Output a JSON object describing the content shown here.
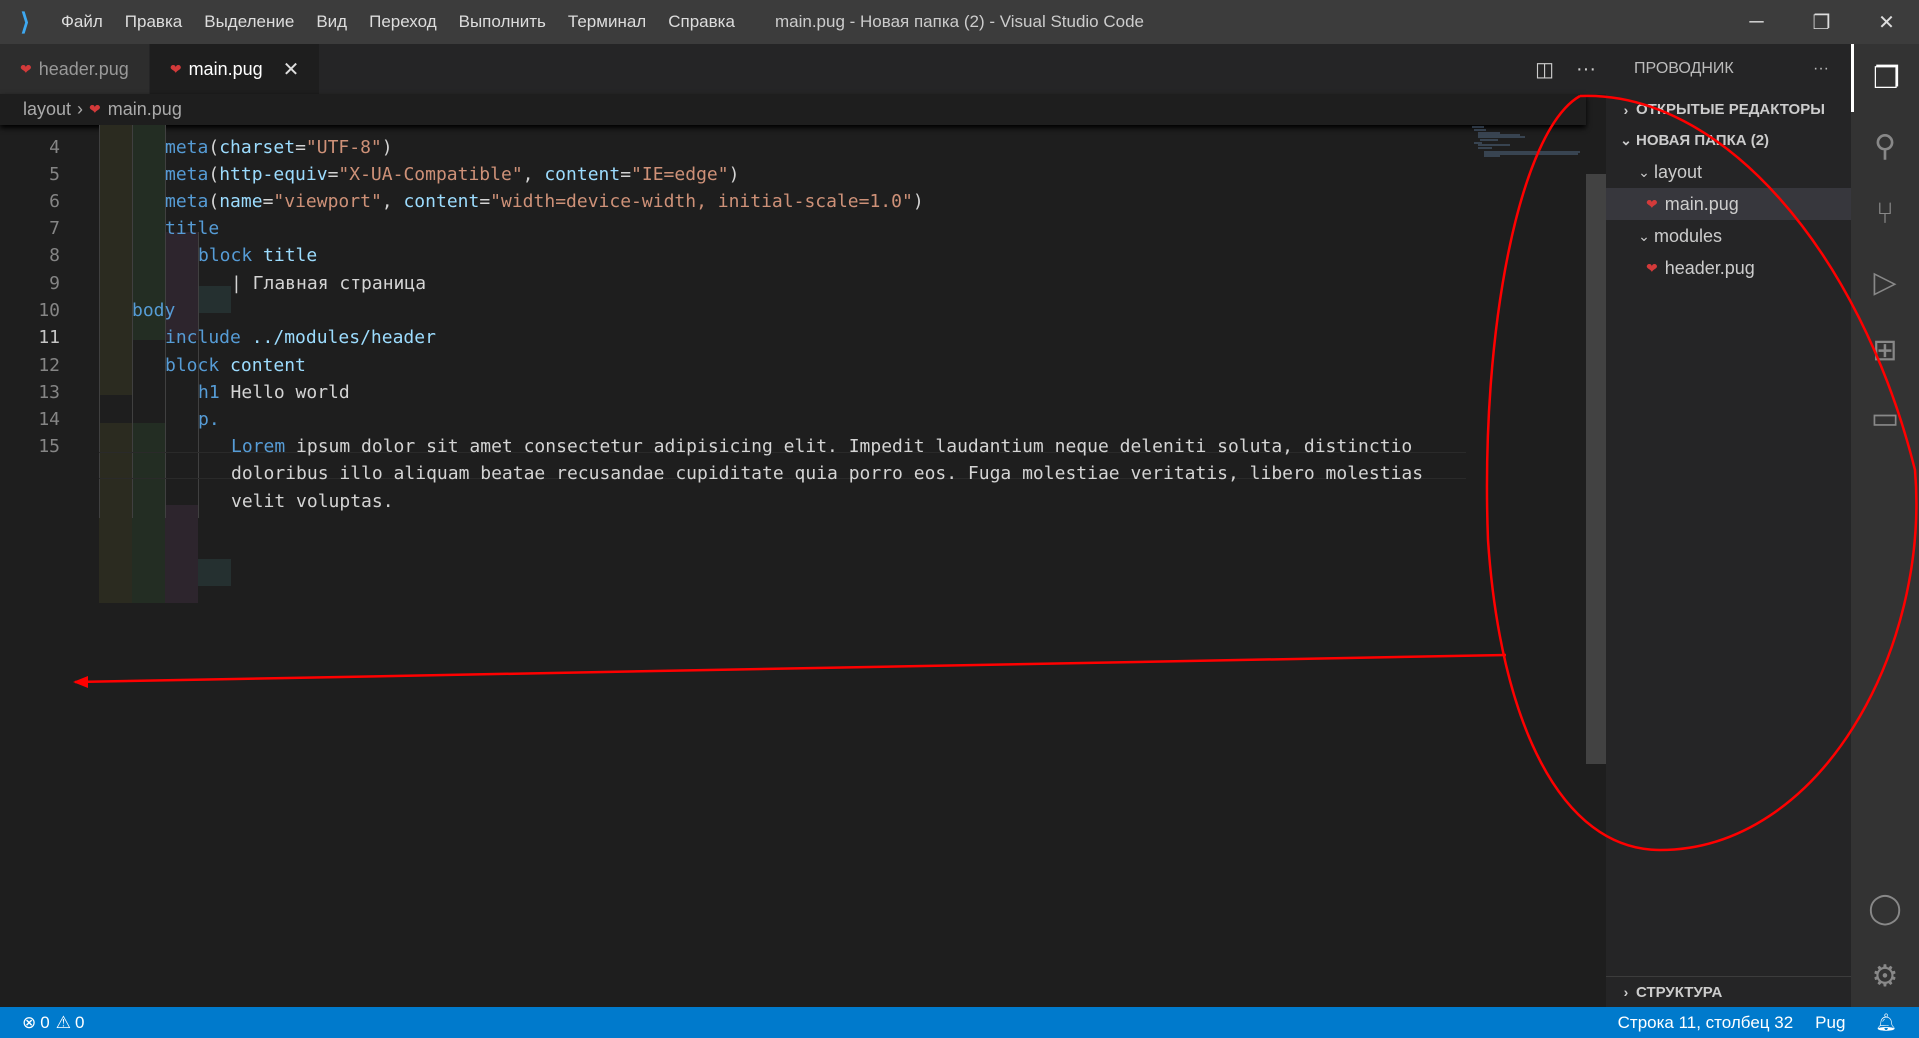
{
  "window": {
    "title": "main.pug - Новая папка (2) - Visual Studio Code",
    "minimize": "─",
    "restore": "❐",
    "close": "✕"
  },
  "menu": [
    "Файл",
    "Правка",
    "Выделение",
    "Вид",
    "Переход",
    "Выполнить",
    "Терминал",
    "Справка"
  ],
  "tabs": [
    {
      "label": "header.pug"
    },
    {
      "label": "main.pug",
      "close": "✕"
    }
  ],
  "breadcrumb": {
    "folder": "layout",
    "sep": "›",
    "file": "main.pug"
  },
  "editor": {
    "current_line": 11,
    "lines": [
      {
        "n": "4"
      },
      {
        "n": "5"
      },
      {
        "n": "6"
      },
      {
        "n": "7"
      },
      {
        "n": "8"
      },
      {
        "n": "9"
      },
      {
        "n": "10"
      },
      {
        "n": "11"
      },
      {
        "n": "12"
      },
      {
        "n": "13"
      },
      {
        "n": "14"
      },
      {
        "n": "15"
      }
    ],
    "code": {
      "l4": [
        "meta",
        "(",
        "charset",
        "=",
        "\"UTF-8\"",
        ")"
      ],
      "l5": [
        "meta",
        "(",
        "http-equiv",
        "=",
        "\"X-UA-Compatible\"",
        ", ",
        "content",
        "=",
        "\"IE=edge\"",
        ")"
      ],
      "l6": [
        "meta",
        "(",
        "name",
        "=",
        "\"viewport\"",
        ", ",
        "content",
        "=",
        "\"width=device-width, initial-scale=1.0\"",
        ")"
      ],
      "l7": [
        "title"
      ],
      "l8": [
        "block",
        " title"
      ],
      "l9": [
        "| Главная страница"
      ],
      "l10": [
        "body"
      ],
      "l11": [
        "include",
        " ../modules/header"
      ],
      "l12": [
        "block",
        " content"
      ],
      "l13": [
        "h1",
        " Hello world"
      ],
      "l14": [
        "p."
      ],
      "l15": [
        "Lorem",
        " ipsum dolor sit amet consectetur adipisicing elit. Impedit laudantium neque deleniti soluta, distinctio",
        "doloribus illo aliquam beatae recusandae cupiditate quia porro eos. Fuga molestiae veritatis, libero molestias",
        "velit voluptas."
      ]
    }
  },
  "explorer": {
    "title": "ПРОВОДНИК",
    "more": "···",
    "open_editors": "ОТКРЫТЫЕ РЕДАКТОРЫ",
    "folder": "НОВАЯ ПАПКА (2)",
    "tree": [
      {
        "label": "layout"
      },
      {
        "label": "main.pug"
      },
      {
        "label": "modules"
      },
      {
        "label": "header.pug"
      }
    ],
    "outline": "СТРУКТУРА"
  },
  "status": {
    "errors": "0",
    "warnings": "0",
    "position": "Строка 11, столбец 32",
    "language": "Pug"
  },
  "colors": {
    "accent": "#007acc",
    "annotation": "#ff0000"
  }
}
